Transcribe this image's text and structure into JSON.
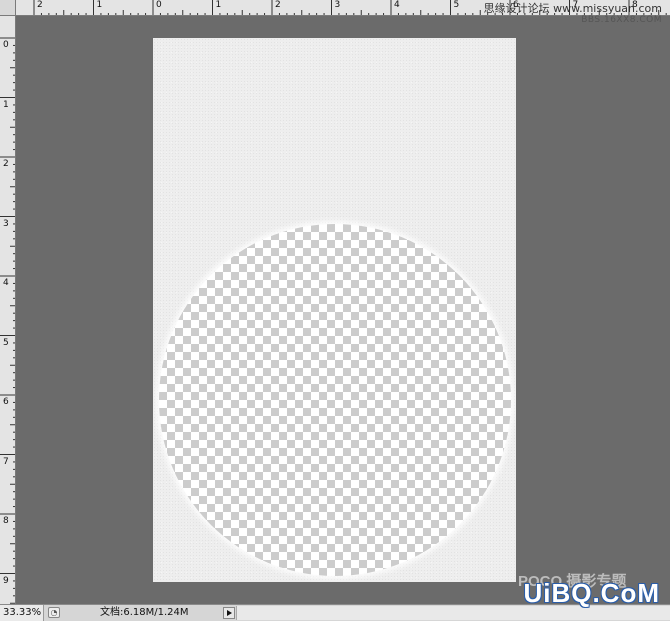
{
  "rulers": {
    "top_labels": [
      "2",
      "1",
      "0",
      "1",
      "2",
      "3",
      "4",
      "5",
      "6",
      "7",
      "8"
    ],
    "left_labels": [
      "0",
      "1",
      "2",
      "3",
      "4",
      "5",
      "6",
      "7",
      "8",
      "9"
    ]
  },
  "document": {
    "texture": "light gray noise",
    "circle": "transparent checkerboard"
  },
  "status_bar": {
    "zoom": "33.33%",
    "doc_info": "文档:6.18M/1.24M"
  },
  "watermarks": {
    "top_line1": "思缘设计论坛 www.missyuan.com",
    "top_line2": "BBS.16XX8.COM",
    "bottom_faded": "POCO 摄影专题",
    "bottom": "UiBQ.CoM"
  },
  "colors": {
    "workspace": "#6b6b6b",
    "ruler": "#e4e4e4",
    "document": "#eeeeee",
    "checker": "#cccccc",
    "watermark_blue": "#2a5da8"
  }
}
